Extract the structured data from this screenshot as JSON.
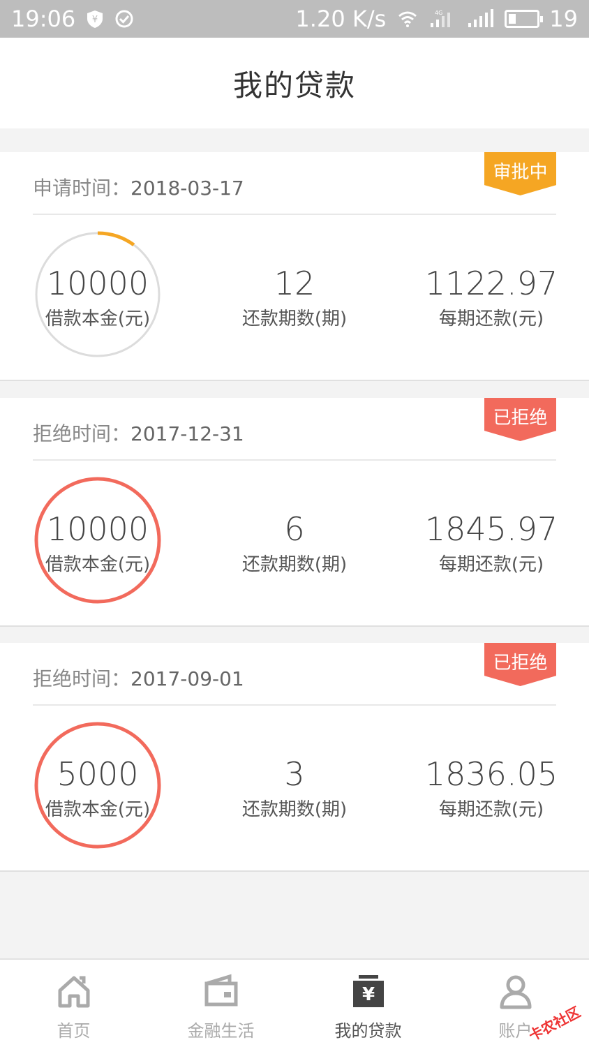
{
  "status_bar": {
    "time": "19:06",
    "speed": "1.20 K/s",
    "signal_type": "4G",
    "battery": "19",
    "icons": [
      "shield-yen-icon",
      "check-circle-icon",
      "wifi-icon",
      "signal-4g-icon",
      "signal-icon",
      "battery-icon"
    ]
  },
  "header": {
    "title": "我的贷款"
  },
  "loans": [
    {
      "date_label": "申请时间：",
      "date": "2018-03-17",
      "status": "审批中",
      "status_color": "#f5a623",
      "principal": "10000",
      "principal_label": "借款本金(元)",
      "periods": "12",
      "periods_label": "还款期数(期)",
      "payment": "1122.97",
      "payment_label": "每期还款(元)",
      "progress": 0.1
    },
    {
      "date_label": "拒绝时间：",
      "date": "2017-12-31",
      "status": "已拒绝",
      "status_color": "#f26a5c",
      "principal": "10000",
      "principal_label": "借款本金(元)",
      "periods": "6",
      "periods_label": "还款期数(期)",
      "payment": "1845.97",
      "payment_label": "每期还款(元)",
      "progress": 1.0
    },
    {
      "date_label": "拒绝时间：",
      "date": "2017-09-01",
      "status": "已拒绝",
      "status_color": "#f26a5c",
      "principal": "5000",
      "principal_label": "借款本金(元)",
      "periods": "3",
      "periods_label": "还款期数(期)",
      "payment": "1836.05",
      "payment_label": "每期还款(元)",
      "progress": 1.0
    }
  ],
  "nav": {
    "items": [
      {
        "label": "首页",
        "icon": "home-icon"
      },
      {
        "label": "金融生活",
        "icon": "wallet-icon"
      },
      {
        "label": "我的贷款",
        "icon": "loan-yen-icon"
      },
      {
        "label": "账户",
        "icon": "user-icon"
      }
    ],
    "active_index": 2
  },
  "watermark": "卡农社区"
}
